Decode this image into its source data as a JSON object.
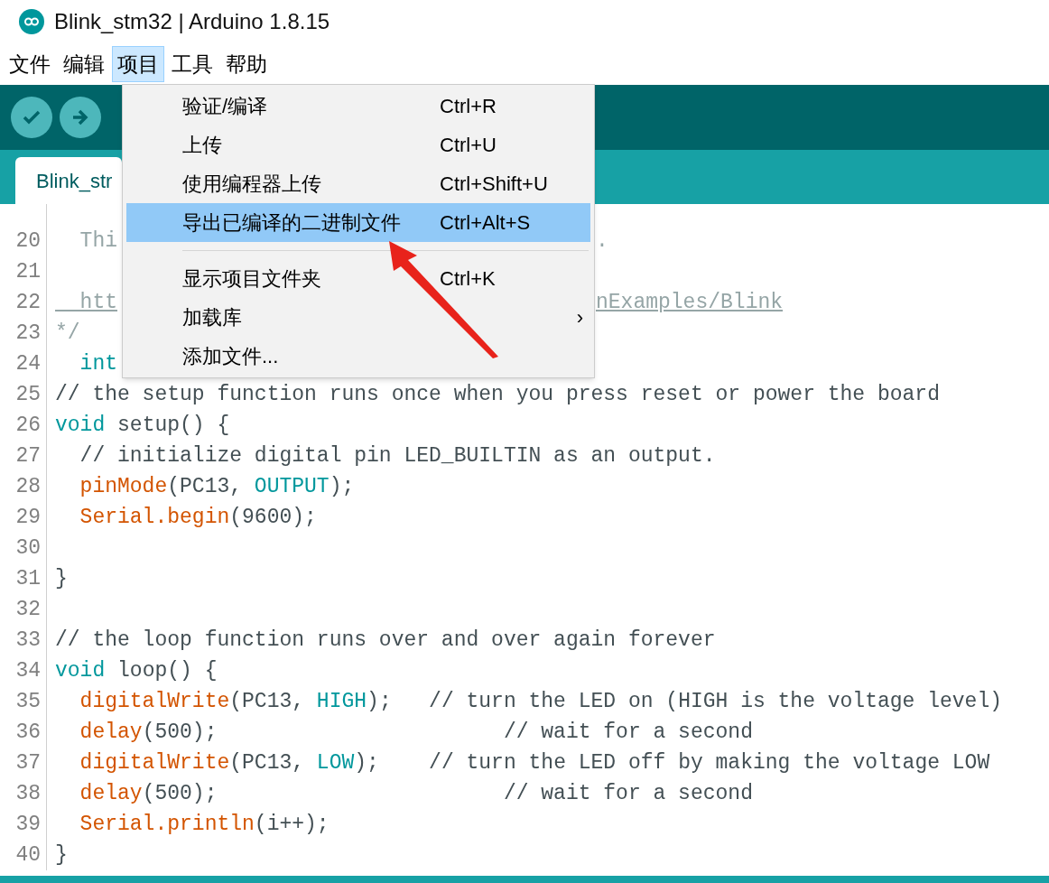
{
  "window": {
    "title": "Blink_stm32 | Arduino 1.8.15"
  },
  "menu_bar": [
    {
      "label": "文件",
      "selected": false
    },
    {
      "label": "编辑",
      "selected": false
    },
    {
      "label": "项目",
      "selected": true
    },
    {
      "label": "工具",
      "selected": false
    },
    {
      "label": "帮助",
      "selected": false
    }
  ],
  "tabs": [
    {
      "label": "Blink_str",
      "selected": true
    }
  ],
  "editor": {
    "lines": [
      {
        "number": "20",
        "segments": [
          [
            {
              "kind": "doc",
              "text": "  Thi"
            }
          ],
          [
            {
              "kind": "doc",
              "text": "."
            }
          ]
        ]
      },
      {
        "number": "21"
      },
      {
        "number": "22",
        "segments": [
          [
            {
              "kind": "link",
              "text": "  htt"
            }
          ],
          [
            {
              "kind": "link",
              "text": "nExamples/Blink"
            }
          ]
        ]
      },
      {
        "number": "23",
        "segments": [
          [
            {
              "kind": "doc",
              "text": "*/"
            }
          ]
        ]
      },
      {
        "number": "24",
        "segments": [
          [
            {
              "kind": "keyword",
              "text": "  int"
            }
          ]
        ]
      },
      {
        "number": "25",
        "segments": [
          [
            {
              "kind": "comment",
              "text": "// the setup function runs once when you press reset or power the board"
            }
          ]
        ]
      },
      {
        "number": "26",
        "segments": [
          [
            {
              "kind": "keyword",
              "text": "void"
            },
            {
              "kind": "plain",
              "text": " setup() {"
            }
          ]
        ]
      },
      {
        "number": "27",
        "segments": [
          [
            {
              "kind": "comment",
              "text": "  // initialize digital pin LED_BUILTIN as an output."
            }
          ]
        ]
      },
      {
        "number": "28",
        "segments": [
          [
            {
              "kind": "function",
              "text": "  pinMode"
            },
            {
              "kind": "plain",
              "text": "(PC13, "
            },
            {
              "kind": "constant",
              "text": "OUTPUT"
            },
            {
              "kind": "plain",
              "text": ");"
            }
          ]
        ]
      },
      {
        "number": "29",
        "segments": [
          [
            {
              "kind": "function",
              "text": "  Serial.begin"
            },
            {
              "kind": "plain",
              "text": "(9600);"
            }
          ]
        ]
      },
      {
        "number": "30"
      },
      {
        "number": "31",
        "segments": [
          [
            {
              "kind": "plain",
              "text": "}"
            }
          ]
        ]
      },
      {
        "number": "32"
      },
      {
        "number": "33",
        "segments": [
          [
            {
              "kind": "comment",
              "text": "// the loop function runs over and over again forever"
            }
          ]
        ]
      },
      {
        "number": "34",
        "segments": [
          [
            {
              "kind": "keyword",
              "text": "void"
            },
            {
              "kind": "plain",
              "text": " loop() {"
            }
          ]
        ]
      },
      {
        "number": "35",
        "segments": [
          [
            {
              "kind": "function",
              "text": "  digitalWrite"
            },
            {
              "kind": "plain",
              "text": "(PC13, "
            },
            {
              "kind": "constant",
              "text": "HIGH"
            },
            {
              "kind": "plain",
              "text": ");   "
            },
            {
              "kind": "comment",
              "text": "// turn the LED on (HIGH is the voltage level)"
            }
          ]
        ]
      },
      {
        "number": "36",
        "segments": [
          [
            {
              "kind": "function",
              "text": "  delay"
            },
            {
              "kind": "plain",
              "text": "(500);                       "
            },
            {
              "kind": "comment",
              "text": "// wait for a second"
            }
          ]
        ]
      },
      {
        "number": "37",
        "segments": [
          [
            {
              "kind": "function",
              "text": "  digitalWrite"
            },
            {
              "kind": "plain",
              "text": "(PC13, "
            },
            {
              "kind": "constant",
              "text": "LOW"
            },
            {
              "kind": "plain",
              "text": ");    "
            },
            {
              "kind": "comment",
              "text": "// turn the LED off by making the voltage LOW"
            }
          ]
        ]
      },
      {
        "number": "38",
        "segments": [
          [
            {
              "kind": "function",
              "text": "  delay"
            },
            {
              "kind": "plain",
              "text": "(500);                       "
            },
            {
              "kind": "comment",
              "text": "// wait for a second"
            }
          ]
        ]
      },
      {
        "number": "39",
        "segments": [
          [
            {
              "kind": "function",
              "text": "  Serial.println"
            },
            {
              "kind": "plain",
              "text": "(i++);"
            }
          ]
        ]
      },
      {
        "number": "40",
        "segments": [
          [
            {
              "kind": "plain",
              "text": "}"
            }
          ]
        ]
      }
    ]
  },
  "dropdown_menu": {
    "items": [
      {
        "kind": "item",
        "label": "验证/编译",
        "shortcut": "Ctrl+R",
        "selected": false
      },
      {
        "kind": "item",
        "label": "上传",
        "shortcut": "Ctrl+U",
        "selected": false
      },
      {
        "kind": "item",
        "label": "使用编程器上传",
        "shortcut": "Ctrl+Shift+U",
        "selected": false
      },
      {
        "kind": "item",
        "label": "导出已编译的二进制文件",
        "shortcut": "Ctrl+Alt+S",
        "selected": true
      },
      {
        "kind": "separator"
      },
      {
        "kind": "item",
        "label": "显示项目文件夹",
        "shortcut": "Ctrl+K",
        "selected": false
      },
      {
        "kind": "submenu",
        "label": "加载库",
        "arrow": "›",
        "selected": false
      },
      {
        "kind": "item",
        "label": "添加文件...",
        "selected": false
      }
    ]
  }
}
